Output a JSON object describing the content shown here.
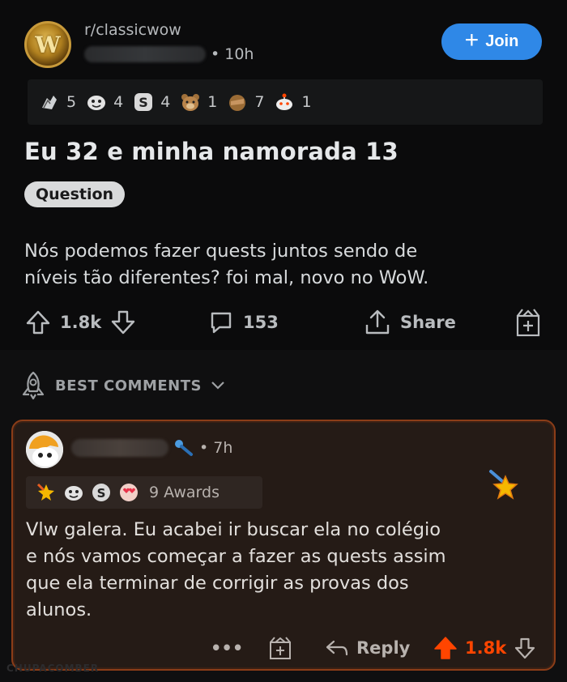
{
  "post": {
    "subreddit": "r/classicwow",
    "subreddit_logo_letter": "W",
    "time": "• 10h",
    "join_label": "Join",
    "join_plus": "+",
    "awards": [
      {
        "icon": "hands-award-icon",
        "count": "5"
      },
      {
        "icon": "face-award-icon",
        "count": "4"
      },
      {
        "icon": "silver-award-icon",
        "count": "4"
      },
      {
        "icon": "bear-award-icon",
        "count": "1"
      },
      {
        "icon": "facepalm-award-icon",
        "count": "7"
      },
      {
        "icon": "snoo-award-icon",
        "count": "1"
      }
    ],
    "title": "Eu 32 e minha namorada 13",
    "flair": "Question",
    "body_lines": [
      "Nós podemos fazer quests juntos sendo de",
      "níveis tão diferentes? foi mal, novo no WoW."
    ],
    "upvotes": "1.8k",
    "comments": "153",
    "share_label": "Share"
  },
  "best_comments_label": "BEST COMMENTS",
  "comment": {
    "time": "• 7h",
    "awards_label": "9 Awards",
    "body_lines": [
      "Vlw galera. Eu acabei ir buscar ela no colégio",
      "e nós vamos começar a fazer as quests assim",
      "que ela terminar de corrigir as provas dos",
      "alunos."
    ],
    "more_label": "•••",
    "reply_label": "Reply",
    "votes": "1.8k"
  },
  "colors": {
    "join": "#2f88e7",
    "upvote_active": "#ff4500",
    "comment_border": "#8b3d18"
  },
  "watermark": "CHUPACOMBER"
}
